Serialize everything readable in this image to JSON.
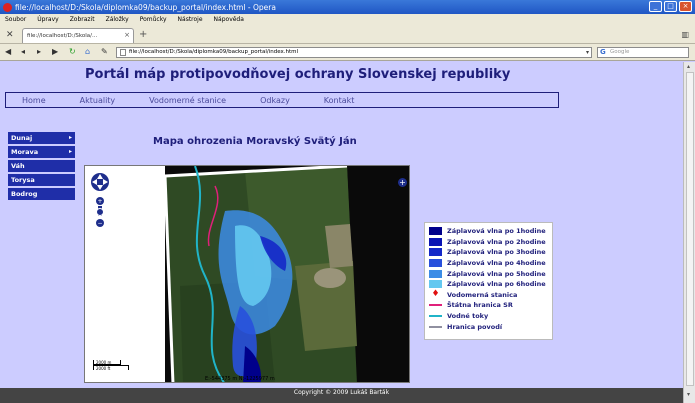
{
  "window": {
    "title": "file://localhost/D:/Skola/diplomka09/backup_portal/index.html - Opera"
  },
  "menu": [
    "Soubor",
    "Úpravy",
    "Zobrazit",
    "Záložky",
    "Pomůcky",
    "Nástroje",
    "Nápověda"
  ],
  "tab": {
    "label": "file://localhost/D:/Skola/..."
  },
  "address": {
    "url": "file://localhost/D:/Skola/diplomka09/backup_portal/index.html"
  },
  "search": {
    "placeholder": "Google"
  },
  "page": {
    "title": "Portál máp protipovodňovej ochrany Slovenskej republiky",
    "nav": [
      "Home",
      "Aktuality",
      "Vodomerné stanice",
      "Odkazy",
      "Kontakt"
    ],
    "sidebar": [
      {
        "label": "Dunaj",
        "arrow": "▸"
      },
      {
        "label": "Morava",
        "arrow": "▸"
      },
      {
        "label": "Váh",
        "arrow": ""
      },
      {
        "label": "Torysa",
        "arrow": ""
      },
      {
        "label": "Bodrog",
        "arrow": ""
      }
    ],
    "map_title": "Mapa ohrozenia Moravský Svätý Ján",
    "scale": {
      "top": "2000 m",
      "bottom": "2000 ft"
    },
    "coords": "E:-544375 m     N:-1225977 m",
    "legend": [
      {
        "label": "Záplavová vlna po 1hodine",
        "kind": "swatch",
        "color": "#00008b"
      },
      {
        "label": "Záplavová vlna po 2hodine",
        "kind": "swatch",
        "color": "#0a14b4"
      },
      {
        "label": "Záplavová vlna po 3hodine",
        "kind": "swatch",
        "color": "#1428c8"
      },
      {
        "label": "Záplavová vlna po 4hodine",
        "kind": "swatch",
        "color": "#2850dc"
      },
      {
        "label": "Záplavová vlna po 5hodine",
        "kind": "swatch",
        "color": "#3c8ce6"
      },
      {
        "label": "Záplavová vlna po 6hodine",
        "kind": "swatch",
        "color": "#64c8f0"
      },
      {
        "label": "Vodomerná stanica",
        "kind": "marker",
        "color": "#e01010"
      },
      {
        "label": "Štátna hranica SR",
        "kind": "line",
        "color": "#e0207a"
      },
      {
        "label": "Vodné toky",
        "kind": "line",
        "color": "#20b4c8"
      },
      {
        "label": "Hranica povodí",
        "kind": "line",
        "color": "#9090a0"
      }
    ],
    "footer": "Copyright © 2009 Lukáš Barták"
  }
}
